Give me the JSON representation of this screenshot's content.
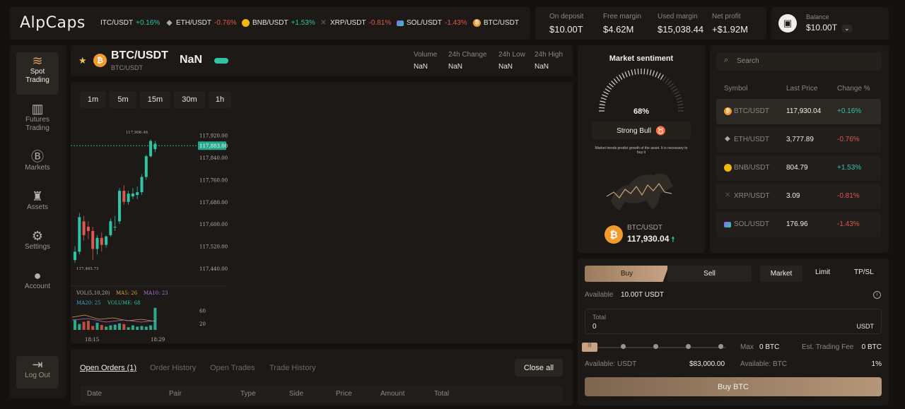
{
  "brand": "AlpCaps",
  "tickers": [
    {
      "symbol": "ITC/USDT",
      "change": "+0.16%",
      "dir": "up",
      "icon": "none"
    },
    {
      "symbol": "ETH/USDT",
      "change": "-0.76%",
      "dir": "down",
      "icon": "eth"
    },
    {
      "symbol": "BNB/USDT",
      "change": "+1.53%",
      "dir": "up",
      "icon": "bnb"
    },
    {
      "symbol": "XRP/USDT",
      "change": "-0.81%",
      "dir": "down",
      "icon": "xrp"
    },
    {
      "symbol": "SOL/USDT",
      "change": "-1.43%",
      "dir": "down",
      "icon": "sol"
    },
    {
      "symbol": "BTC/USDT",
      "change": "",
      "dir": "up",
      "icon": "btc"
    }
  ],
  "account": {
    "on_deposit_label": "On deposit",
    "on_deposit": "$10.00T",
    "free_margin_label": "Free margin",
    "free_margin": "$4.62M",
    "used_margin_label": "Used margin",
    "used_margin": "$15,038.44",
    "net_profit_label": "Net profit",
    "net_profit": "+$1.92M",
    "balance_label": "Balance",
    "balance": "$10.00T"
  },
  "sidebar": {
    "items": [
      {
        "label1": "Spot",
        "label2": "Trading",
        "icon": "spot-trading-icon"
      },
      {
        "label1": "Futures",
        "label2": "Trading",
        "icon": "futures-icon"
      },
      {
        "label1": "Markets",
        "label2": "",
        "icon": "bitcoin-icon"
      },
      {
        "label1": "Assets",
        "label2": "",
        "icon": "assets-icon"
      },
      {
        "label1": "Settings",
        "label2": "",
        "icon": "gear-icon"
      },
      {
        "label1": "Account",
        "label2": "",
        "icon": "user-icon"
      }
    ],
    "logout": "Log Out"
  },
  "pair": {
    "name": "BTC/USDT",
    "sub": "BTC/USDT",
    "price": "NaN",
    "volume_label": "Volume",
    "volume": "NaN",
    "change_label": "24h Change",
    "change": "NaN",
    "low_label": "24h Low",
    "low": "NaN",
    "high_label": "24h High",
    "high": "NaN"
  },
  "timeframes": [
    "1m",
    "5m",
    "15m",
    "30m",
    "1h"
  ],
  "chart_data": {
    "type": "candlestick",
    "price_ticks": [
      "117,920.00",
      "117,840.00",
      "117,760.00",
      "117,680.00",
      "117,600.00",
      "117,520.00",
      "117,440.00"
    ],
    "price_tick_values": [
      117920,
      117840,
      117760,
      117680,
      117600,
      117520,
      117440
    ],
    "ylim": [
      117450,
      117960
    ],
    "current_price_label": "117,883.00",
    "current_price": 117883,
    "high_marker": "117,906.46",
    "low_marker": "117,465.73",
    "candles": [
      {
        "o": 117470,
        "h": 117520,
        "l": 117460,
        "c": 117500,
        "dir": "up"
      },
      {
        "o": 117500,
        "h": 117640,
        "l": 117490,
        "c": 117625,
        "dir": "up"
      },
      {
        "o": 117610,
        "h": 117630,
        "l": 117540,
        "c": 117560,
        "dir": "down"
      },
      {
        "o": 117590,
        "h": 117610,
        "l": 117545,
        "c": 117575,
        "dir": "down"
      },
      {
        "o": 117575,
        "h": 117590,
        "l": 117470,
        "c": 117510,
        "dir": "down"
      },
      {
        "o": 117510,
        "h": 117560,
        "l": 117490,
        "c": 117550,
        "dir": "up"
      },
      {
        "o": 117550,
        "h": 117570,
        "l": 117500,
        "c": 117525,
        "dir": "down"
      },
      {
        "o": 117525,
        "h": 117560,
        "l": 117515,
        "c": 117555,
        "dir": "up"
      },
      {
        "o": 117560,
        "h": 117620,
        "l": 117555,
        "c": 117610,
        "dir": "up"
      },
      {
        "o": 117590,
        "h": 117630,
        "l": 117575,
        "c": 117590,
        "dir": "up"
      },
      {
        "o": 117610,
        "h": 117730,
        "l": 117600,
        "c": 117720,
        "dir": "up"
      },
      {
        "o": 117720,
        "h": 117740,
        "l": 117670,
        "c": 117680,
        "dir": "down"
      },
      {
        "o": 117680,
        "h": 117720,
        "l": 117670,
        "c": 117710,
        "dir": "up"
      },
      {
        "o": 117710,
        "h": 117730,
        "l": 117690,
        "c": 117700,
        "dir": "up"
      },
      {
        "o": 117705,
        "h": 117735,
        "l": 117690,
        "c": 117715,
        "dir": "up"
      },
      {
        "o": 117715,
        "h": 117780,
        "l": 117705,
        "c": 117770,
        "dir": "up"
      },
      {
        "o": 117770,
        "h": 117850,
        "l": 117760,
        "c": 117845,
        "dir": "up"
      },
      {
        "o": 117845,
        "h": 117906,
        "l": 117840,
        "c": 117900,
        "dir": "up"
      },
      {
        "o": 117870,
        "h": 117900,
        "l": 117860,
        "c": 117890,
        "dir": "up"
      }
    ],
    "volume_legend": {
      "vol": "VOL(5,10,20)",
      "ma5": "MA5: 26",
      "ma10": "MA10: 23",
      "ma20": "MA20: 25",
      "volume": "VOLUME: 68"
    },
    "volume_ticks": [
      "60",
      "20"
    ],
    "volume_tick_values": [
      60,
      20
    ],
    "volumes": [
      30,
      18,
      25,
      28,
      12,
      22,
      15,
      10,
      14,
      16,
      20,
      18,
      8,
      14,
      10,
      12,
      10,
      14,
      68
    ],
    "time_labels": [
      "18:15",
      "18:29"
    ]
  },
  "orders": {
    "tabs": [
      "Open Orders (1)",
      "Order History",
      "Open Trades",
      "Trade History"
    ],
    "close_all": "Close all",
    "columns": [
      "Date",
      "Pair",
      "Type",
      "Side",
      "Price",
      "Amount",
      "Total"
    ]
  },
  "sentiment": {
    "title": "Market sentiment",
    "percent": "68%",
    "percent_value": 68,
    "status": "Strong Bull",
    "description": "Market trends predict growth of the asset. It is necessary to buy it",
    "pair": "BTC/USDT",
    "price": "117,930.04"
  },
  "markets": {
    "search_placeholder": "Search",
    "headers": [
      "Symbol",
      "Last Price",
      "Change %"
    ],
    "rows": [
      {
        "symbol": "BTC/USDT",
        "price": "117,930.04",
        "change": "+0.16%",
        "dir": "up",
        "icon": "btc"
      },
      {
        "symbol": "ETH/USDT",
        "price": "3,777.89",
        "change": "-0.76%",
        "dir": "down",
        "icon": "eth"
      },
      {
        "symbol": "BNB/USDT",
        "price": "804.79",
        "change": "+1.53%",
        "dir": "up",
        "icon": "bnb"
      },
      {
        "symbol": "XRP/USDT",
        "price": "3.09",
        "change": "-0.81%",
        "dir": "down",
        "icon": "xrp"
      },
      {
        "symbol": "SOL/USDT",
        "price": "176.96",
        "change": "-1.43%",
        "dir": "down",
        "icon": "sol"
      }
    ]
  },
  "trade": {
    "buy": "Buy",
    "sell": "Sell",
    "market": "Market",
    "limit": "Limit",
    "tpsl": "TP/SL",
    "available_label": "Available",
    "available": "10.00T USDT",
    "total_label": "Total",
    "total_value": "0",
    "total_unit": "USDT",
    "max_label": "Max",
    "max_value": "0 BTC",
    "fee_label": "Est. Trading Fee",
    "fee_value": "0 BTC",
    "avail_usdt_label": "Available: USDT",
    "avail_usdt": "$83,000.00",
    "avail_btc_label": "Available: BTC",
    "avail_btc": "1%",
    "buy_btn": "Buy BTC"
  }
}
